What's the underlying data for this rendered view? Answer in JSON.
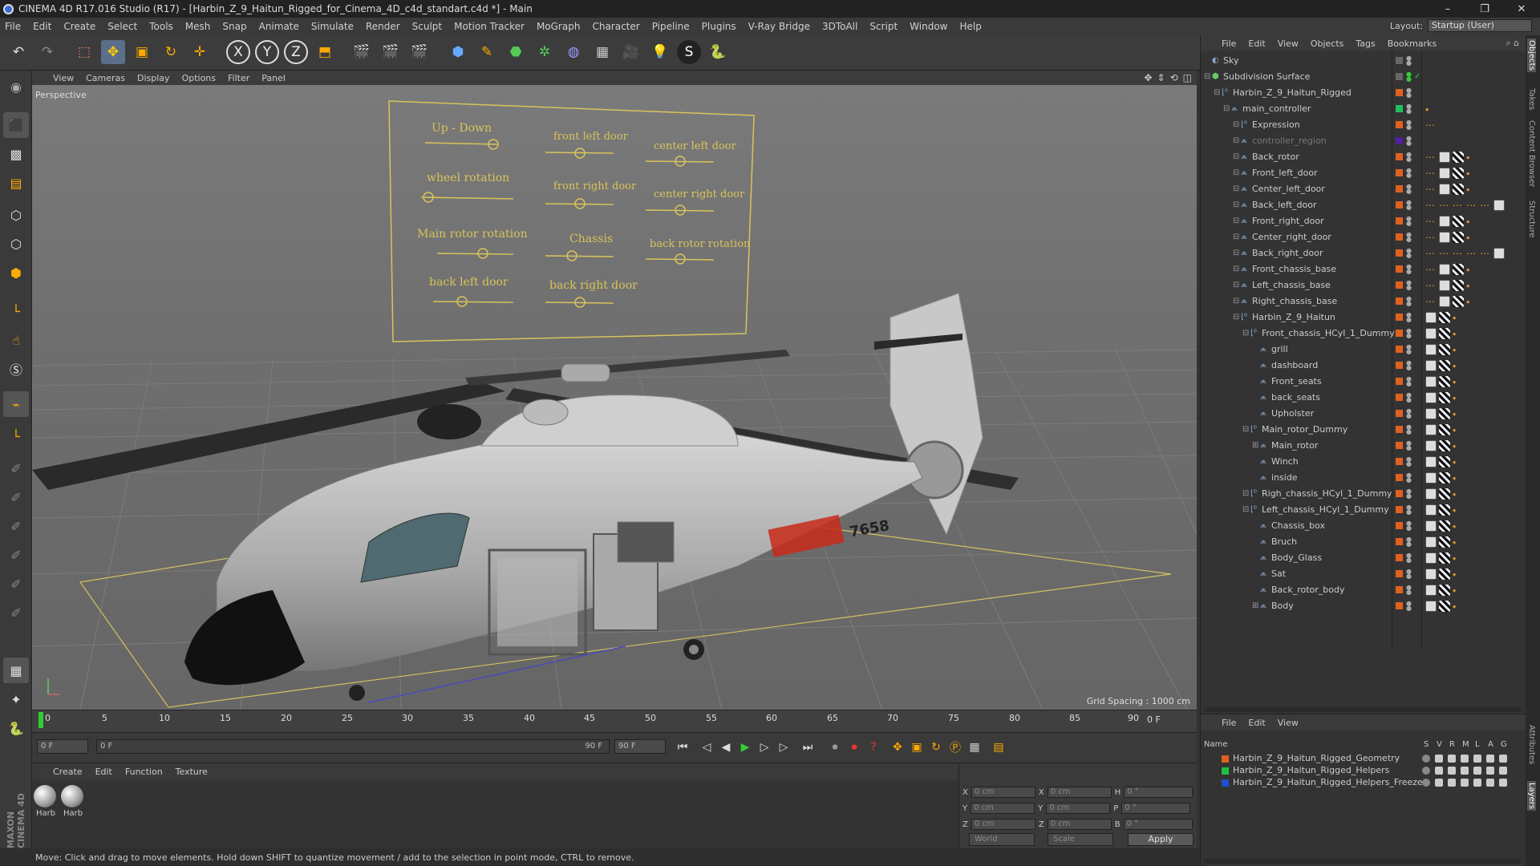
{
  "window": {
    "title": "CINEMA 4D R17.016 Studio (R17) - [Harbin_Z_9_Haitun_Rigged_for_Cinema_4D_c4d_standart.c4d *] - Main",
    "controls": [
      "–",
      "❐",
      "✕"
    ]
  },
  "menu": [
    "File",
    "Edit",
    "Create",
    "Select",
    "Tools",
    "Mesh",
    "Snap",
    "Animate",
    "Simulate",
    "Render",
    "Sculpt",
    "Motion Tracker",
    "MoGraph",
    "Character",
    "Pipeline",
    "Plugins",
    "V-Ray Bridge",
    "3DToAll",
    "Script",
    "Window",
    "Help"
  ],
  "layout": {
    "label": "Layout:",
    "value": "Startup (User)"
  },
  "viewport": {
    "menu": [
      "View",
      "Cameras",
      "Display",
      "Options",
      "Filter",
      "Panel"
    ],
    "camera": "Perspective",
    "grid_spacing": "Grid Spacing : 1000 cm",
    "controller_labels": [
      "Up - Down",
      "front left door",
      "center left door",
      "wheel rotation",
      "front right door",
      "center right door",
      "Main rotor rotation",
      "Chassis",
      "back rotor rotation",
      "back left door",
      "back right door"
    ],
    "fuselage_number": "7658"
  },
  "timeline": {
    "ticks": [
      "0",
      "5",
      "10",
      "15",
      "20",
      "25",
      "30",
      "35",
      "40",
      "45",
      "50",
      "55",
      "60",
      "65",
      "70",
      "75",
      "80",
      "85",
      "90"
    ],
    "frame_right": "0 F"
  },
  "transport": {
    "start": "0 F",
    "slider_start": "0 F",
    "slider_end": "90 F",
    "end": "90 F"
  },
  "material_manager": {
    "menu": [
      "Create",
      "Edit",
      "Function",
      "Texture"
    ],
    "materials": [
      "Harb",
      "Harb"
    ]
  },
  "coords": {
    "labels": [
      "X",
      "Y",
      "Z"
    ],
    "pos": [
      "0 cm",
      "0 cm",
      "0 cm"
    ],
    "size": [
      "0 cm",
      "0 cm",
      "0 cm"
    ],
    "rot_labels": [
      "H",
      "P",
      "B"
    ],
    "rot": [
      "0 °",
      "0 °",
      "0 °"
    ],
    "world": "World",
    "scale": "Scale",
    "apply": "Apply"
  },
  "status": "Move: Click and drag to move elements. Hold down SHIFT to quantize movement / add to the selection in point mode, CTRL to remove.",
  "object_manager": {
    "menu": [
      "File",
      "Edit",
      "View",
      "Objects",
      "Tags",
      "Bookmarks"
    ],
    "objects": [
      {
        "name": "Sky",
        "indent": 0
      },
      {
        "name": "Subdivision Surface",
        "indent": 0
      },
      {
        "name": "Harbin_Z_9_Haitun_Rigged",
        "indent": 1
      },
      {
        "name": "main_controller",
        "indent": 2
      },
      {
        "name": "Expression",
        "indent": 3
      },
      {
        "name": "controller_region",
        "indent": 3
      },
      {
        "name": "Back_rotor",
        "indent": 3
      },
      {
        "name": "Front_left_door",
        "indent": 3
      },
      {
        "name": "Center_left_door",
        "indent": 3
      },
      {
        "name": "Back_left_door",
        "indent": 3
      },
      {
        "name": "Front_right_door",
        "indent": 3
      },
      {
        "name": "Center_right_door",
        "indent": 3
      },
      {
        "name": "Back_right_door",
        "indent": 3
      },
      {
        "name": "Front_chassis_base",
        "indent": 3
      },
      {
        "name": "Left_chassis_base",
        "indent": 3
      },
      {
        "name": "Right_chassis_base",
        "indent": 3
      },
      {
        "name": "Harbin_Z_9_Haitun",
        "indent": 3
      },
      {
        "name": "Front_chassis_HCyl_1_Dummy",
        "indent": 4
      },
      {
        "name": "grill",
        "indent": 5
      },
      {
        "name": "dashboard",
        "indent": 5
      },
      {
        "name": "Front_seats",
        "indent": 5
      },
      {
        "name": "back_seats",
        "indent": 5
      },
      {
        "name": "Upholster",
        "indent": 5
      },
      {
        "name": "Main_rotor_Dummy",
        "indent": 4
      },
      {
        "name": "Main_rotor",
        "indent": 5
      },
      {
        "name": "Winch",
        "indent": 5
      },
      {
        "name": "inside",
        "indent": 5
      },
      {
        "name": "Righ_chassis_HCyl_1_Dummy",
        "indent": 4
      },
      {
        "name": "Left_chassis_HCyl_1_Dummy",
        "indent": 4
      },
      {
        "name": "Chassis_box",
        "indent": 5
      },
      {
        "name": "Bruch",
        "indent": 5
      },
      {
        "name": "Body_Glass",
        "indent": 5
      },
      {
        "name": "Sat",
        "indent": 5
      },
      {
        "name": "Back_rotor_body",
        "indent": 5
      },
      {
        "name": "Body",
        "indent": 5
      }
    ]
  },
  "layer_manager": {
    "menu": [
      "File",
      "Edit",
      "View"
    ],
    "header": {
      "name": "Name",
      "cols": [
        "S",
        "V",
        "R",
        "M",
        "L",
        "A",
        "G"
      ]
    },
    "layers": [
      {
        "name": "Harbin_Z_9_Haitun_Rigged_Geometry",
        "color": "#e06020"
      },
      {
        "name": "Harbin_Z_9_Haitun_Rigged_Helpers",
        "color": "#20c040"
      },
      {
        "name": "Harbin_Z_9_Haitun_Rigged_Helpers_Freeze",
        "color": "#2050d0"
      }
    ]
  },
  "side_tabs": [
    "Objects",
    "Takes",
    "Content Browser",
    "Structure",
    "Attributes",
    "Layers"
  ],
  "brand": "MAXON CINEMA 4D"
}
